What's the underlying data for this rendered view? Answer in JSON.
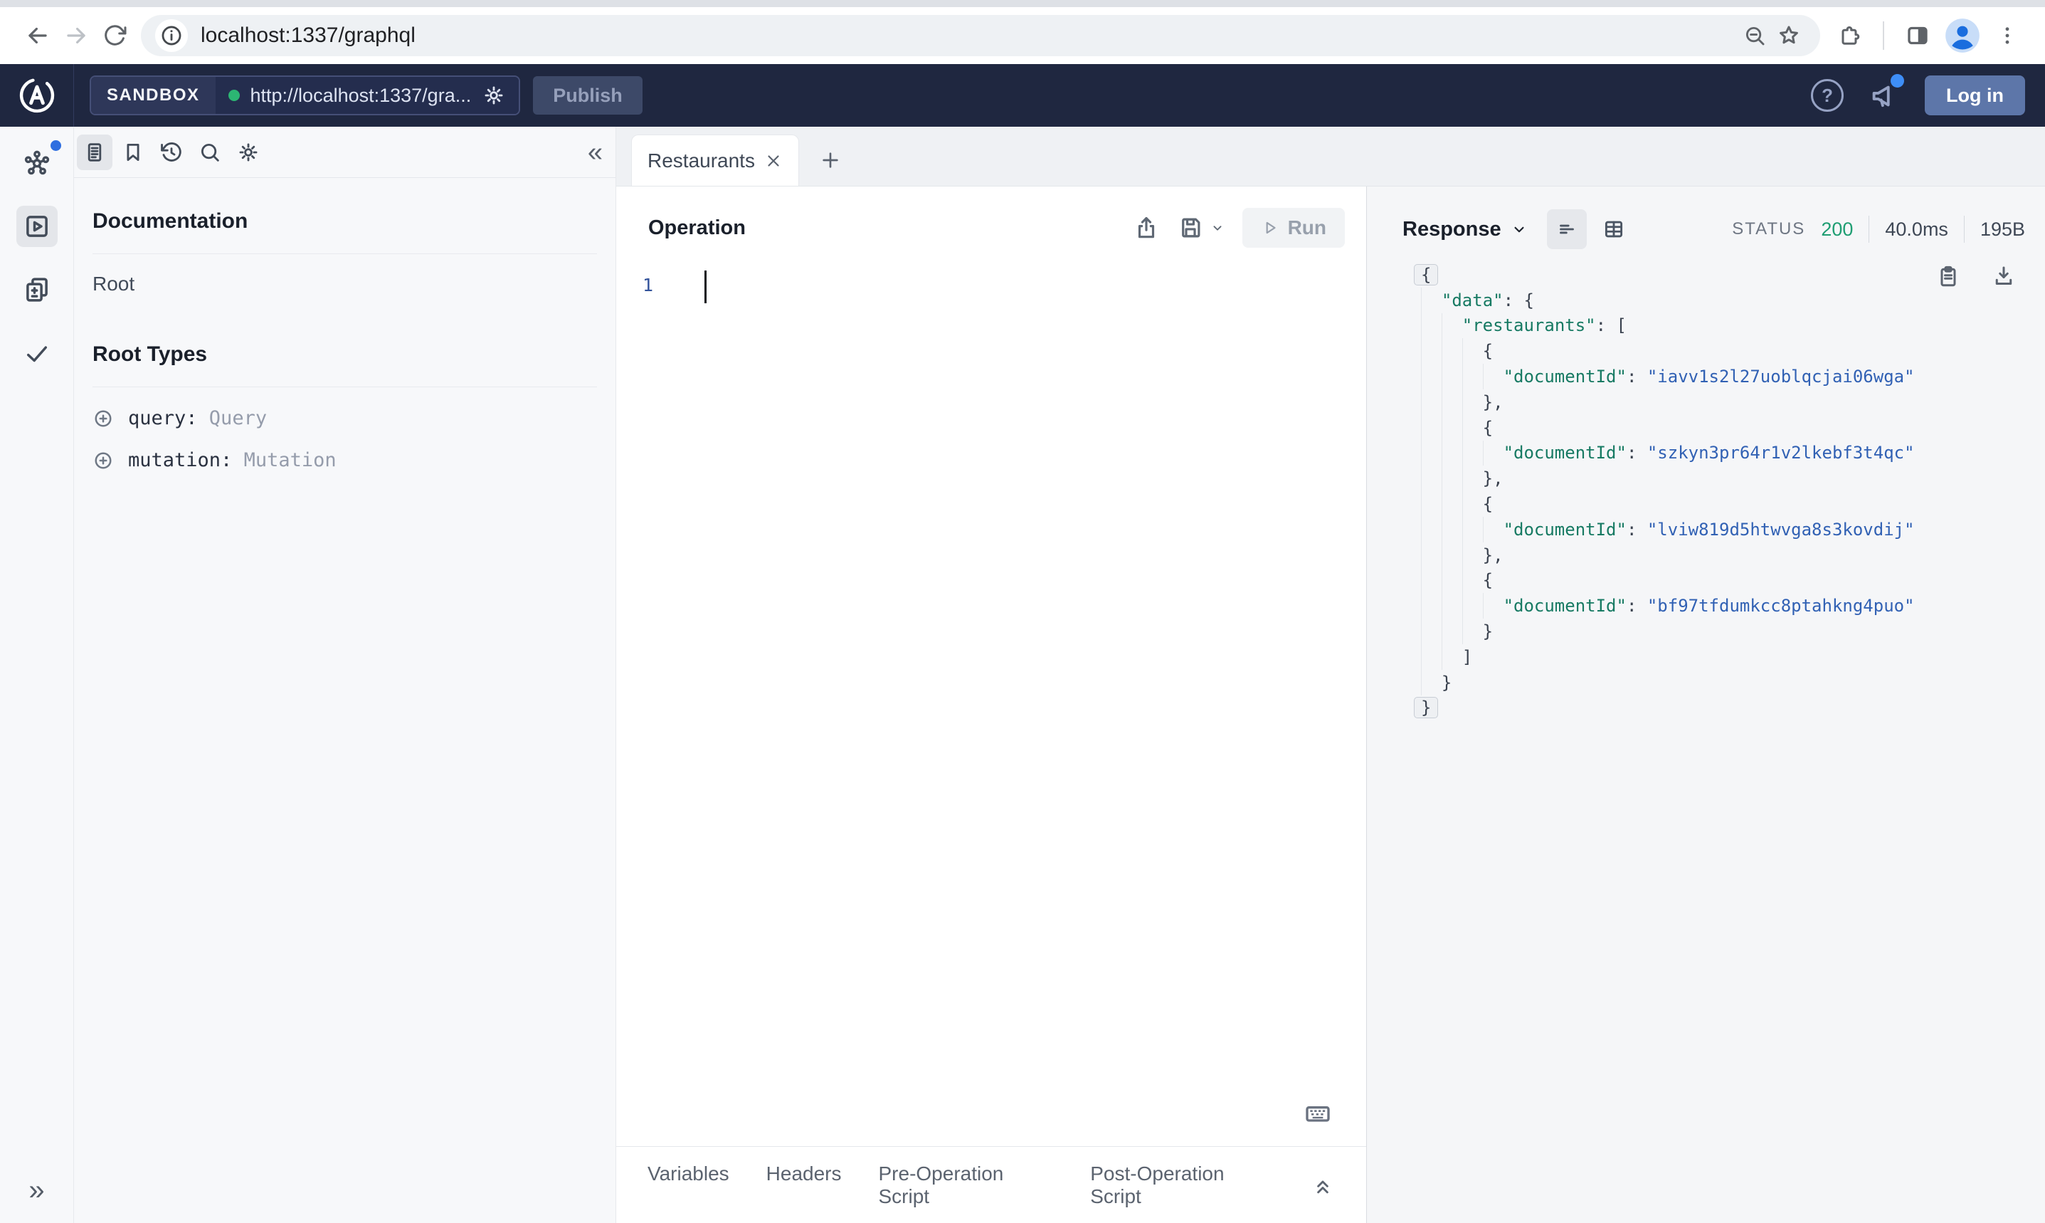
{
  "browser": {
    "url": "localhost:1337/graphql"
  },
  "apollo_header": {
    "env_label": "SANDBOX",
    "endpoint": "http://localhost:1337/gra...",
    "publish_label": "Publish",
    "help_label": "?",
    "login_label": "Log in"
  },
  "doc_panel": {
    "title": "Documentation",
    "root_label": "Root",
    "section_title": "Root Types",
    "root_types": [
      {
        "name": "query",
        "type": "Query"
      },
      {
        "name": "mutation",
        "type": "Mutation"
      }
    ]
  },
  "tabs": {
    "active_label": "Restaurants"
  },
  "operation": {
    "title": "Operation",
    "run_label": "Run",
    "line_number": "1"
  },
  "response": {
    "title": "Response",
    "status_label": "STATUS",
    "status_code": "200",
    "duration": "40.0ms",
    "size": "195B",
    "lines": [
      {
        "i": 0,
        "fold": true,
        "tokens": [
          [
            "p",
            "{"
          ]
        ]
      },
      {
        "i": 1,
        "tokens": [
          [
            "k",
            "\"data\""
          ],
          [
            "p",
            ": {"
          ]
        ]
      },
      {
        "i": 2,
        "tokens": [
          [
            "k",
            "\"restaurants\""
          ],
          [
            "p",
            ": ["
          ]
        ]
      },
      {
        "i": 3,
        "tokens": [
          [
            "p",
            "{"
          ]
        ]
      },
      {
        "i": 4,
        "tokens": [
          [
            "k",
            "\"documentId\""
          ],
          [
            "p",
            ": "
          ],
          [
            "s",
            "\"iavv1s2l27uoblqcjai06wga\""
          ]
        ]
      },
      {
        "i": 3,
        "tokens": [
          [
            "p",
            "},"
          ]
        ]
      },
      {
        "i": 3,
        "tokens": [
          [
            "p",
            "{"
          ]
        ]
      },
      {
        "i": 4,
        "tokens": [
          [
            "k",
            "\"documentId\""
          ],
          [
            "p",
            ": "
          ],
          [
            "s",
            "\"szkyn3pr64r1v2lkebf3t4qc\""
          ]
        ]
      },
      {
        "i": 3,
        "tokens": [
          [
            "p",
            "},"
          ]
        ]
      },
      {
        "i": 3,
        "tokens": [
          [
            "p",
            "{"
          ]
        ]
      },
      {
        "i": 4,
        "tokens": [
          [
            "k",
            "\"documentId\""
          ],
          [
            "p",
            ": "
          ],
          [
            "s",
            "\"lviw819d5htwvga8s3kovdij\""
          ]
        ]
      },
      {
        "i": 3,
        "tokens": [
          [
            "p",
            "},"
          ]
        ]
      },
      {
        "i": 3,
        "tokens": [
          [
            "p",
            "{"
          ]
        ]
      },
      {
        "i": 4,
        "tokens": [
          [
            "k",
            "\"documentId\""
          ],
          [
            "p",
            ": "
          ],
          [
            "s",
            "\"bf97tfdumkcc8ptahkng4puo\""
          ]
        ]
      },
      {
        "i": 3,
        "tokens": [
          [
            "p",
            "}"
          ]
        ]
      },
      {
        "i": 2,
        "tokens": [
          [
            "p",
            "]"
          ]
        ]
      },
      {
        "i": 1,
        "tokens": [
          [
            "p",
            "}"
          ]
        ]
      },
      {
        "i": 0,
        "fold": true,
        "tokens": [
          [
            "p",
            "}"
          ]
        ]
      }
    ]
  },
  "bottom_tabs": [
    "Variables",
    "Headers",
    "Pre-Operation Script",
    "Post-Operation Script"
  ],
  "colors": {
    "apollo_header_bg": "#1f2740",
    "accent_blue": "#2e6ee0",
    "status_green": "#1f9e73",
    "json_key": "#177a63",
    "json_string": "#3161b4",
    "online_dot_green": "#2cb673"
  }
}
